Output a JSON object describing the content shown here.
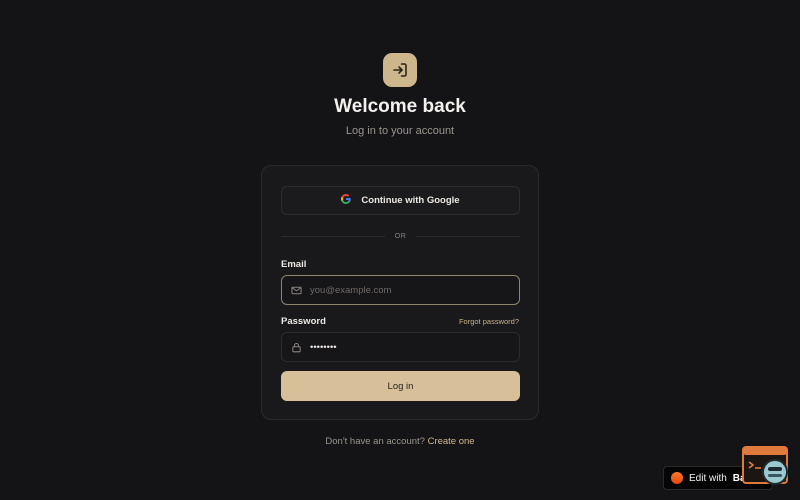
{
  "header": {
    "logo_icon": "sign-in-arrow-icon",
    "title": "Welcome back",
    "subtitle": "Log in to your account"
  },
  "login_card": {
    "google_button": {
      "label": "Continue with Google",
      "icon": "google-g-icon"
    },
    "divider_text": "OR",
    "email": {
      "label": "Email",
      "placeholder": "you@example.com",
      "value": "",
      "icon": "mail-icon"
    },
    "password": {
      "label": "Password",
      "forgot_link": "Forgot password?",
      "value": "password",
      "icon": "lock-icon"
    },
    "submit_label": "Log in"
  },
  "footer": {
    "prompt": "Don't have an account? ",
    "link": "Create one"
  },
  "badge": {
    "prefix": "Edit with ",
    "brand": "Base44"
  },
  "colors": {
    "background": "#141316",
    "card": "#19181b",
    "accent": "#d6bf99",
    "link": "#d1b98f"
  }
}
